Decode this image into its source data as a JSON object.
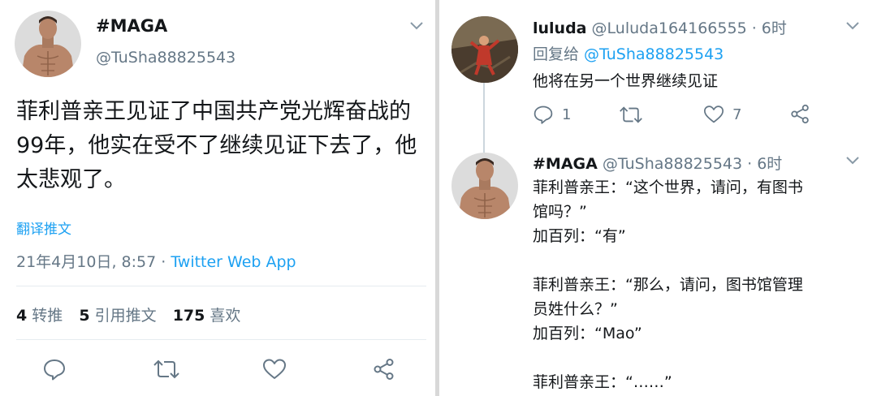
{
  "left_tweet": {
    "display_name": "#MAGA",
    "handle": "@TuSha88825543",
    "text": "菲利普亲王见证了中国共产党光辉奋战的99年，他实在受不了继续见证下去了，他太悲观了。",
    "translate_label": "翻译推文",
    "timestamp": "21年4月10日, 8:57 · ",
    "source": "Twitter Web App",
    "retweets_count": "4",
    "retweets_label": "转推",
    "quotes_count": "5",
    "quotes_label": "引用推文",
    "likes_count": "175",
    "likes_label": "喜欢",
    "icons": [
      "reply-icon",
      "retweet-icon",
      "like-icon",
      "share-icon",
      "chevron-down-icon"
    ]
  },
  "right_thread": {
    "reply": {
      "display_name": "luluda",
      "handle_time": " @Luluda164166555 · 6时",
      "replying_to_label": "回复给 ",
      "replying_to_handle": "@TuSha88825543",
      "text": "他将在另一个世界继续见证",
      "reply_count": "1",
      "retweet_count": "",
      "like_count": "7"
    },
    "tweet": {
      "display_name": "#MAGA",
      "handle_time": " @TuSha88825543 · 6时",
      "lines": [
        "菲利普亲王：“这个世界，请问，有图书",
        "馆吗？”",
        "加百列：“有”",
        "",
        "菲利普亲王：“那么，请问，图书馆管理",
        "员姓什么？”",
        "加百列：“Mao”",
        "",
        "菲利普亲王：“……”"
      ]
    }
  },
  "colors": {
    "link_blue": "#1da1f2",
    "secondary_text": "#657786",
    "primary_text": "#14171a",
    "divider": "#d8d8d8"
  }
}
